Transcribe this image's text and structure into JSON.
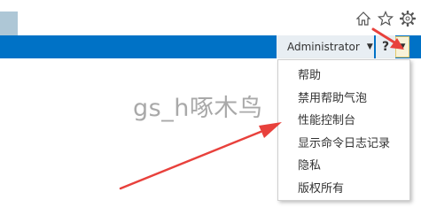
{
  "header": {
    "user_name": "Administrator",
    "help_label": "?",
    "browser_icons": [
      "home-icon",
      "star-icon",
      "gear-icon"
    ]
  },
  "help_menu": {
    "items": [
      "帮助",
      "禁用帮助气泡",
      "性能控制台",
      "显示命令日志记录",
      "隐私",
      "版权所有"
    ]
  },
  "watermark": "gs_h啄木鸟",
  "colors": {
    "suite_bar": "#0072c6",
    "annotation_arrow": "#e8413c"
  }
}
